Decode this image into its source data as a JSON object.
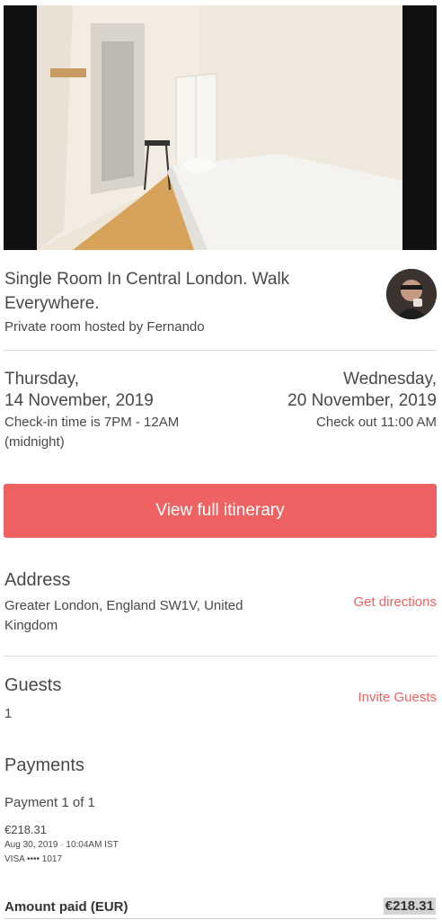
{
  "listing": {
    "title": "Single Room In Central London. Walk Everywhere.",
    "subtitle": "Private room hosted by Fernando"
  },
  "checkin": {
    "day": "Thursday,",
    "date": "14 November, 2019",
    "note": "Check-in time is 7PM - 12AM (midnight)"
  },
  "checkout": {
    "day": "Wednesday,",
    "date": "20 November, 2019",
    "note": "Check out 11:00 AM"
  },
  "cta": {
    "label": "View full itinerary"
  },
  "address": {
    "heading": "Address",
    "text": "Greater London, England SW1V, United Kingdom",
    "link": "Get directions"
  },
  "guests": {
    "heading": "Guests",
    "count": "1",
    "link": "Invite Guests"
  },
  "payments": {
    "heading": "Payments",
    "progress": "Payment 1 of 1",
    "amount": "€218.31",
    "timestamp": "Aug 30, 2019 · 10:04AM IST",
    "card": "VISA •••• 1017",
    "total_label": "Amount paid (EUR)",
    "total_value": "€218.31"
  },
  "colors": {
    "accent": "#ef6262",
    "text": "#484848",
    "divider": "#dcdcdc"
  }
}
